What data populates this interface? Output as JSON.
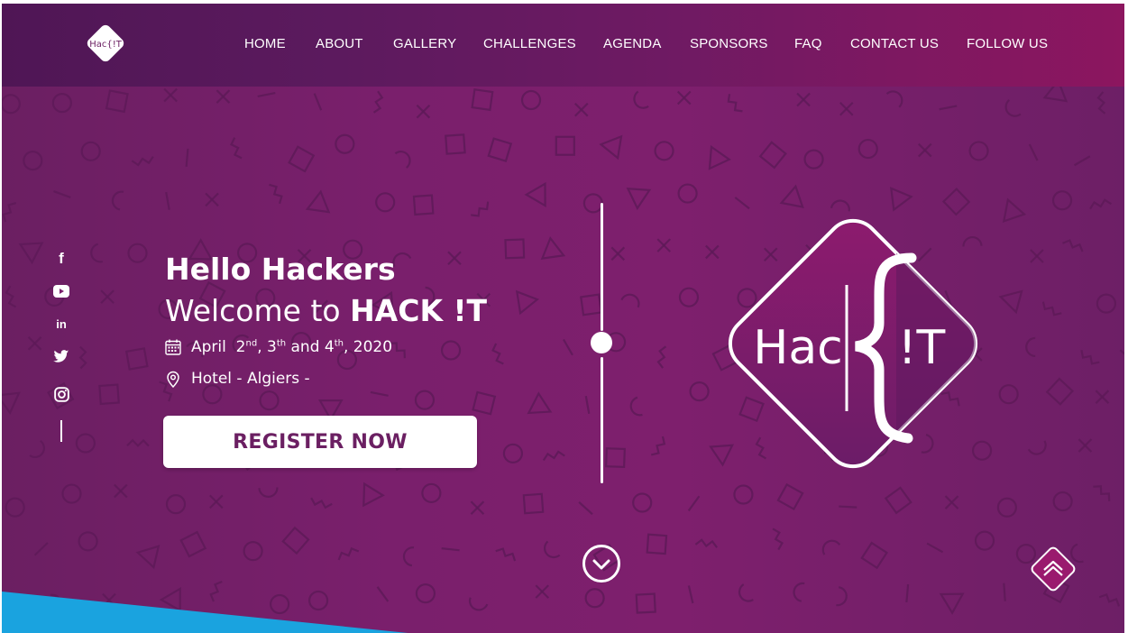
{
  "brand": {
    "logo_text": "Hac{!T",
    "name": "HACK !T"
  },
  "nav": {
    "items": [
      {
        "label": "HOME"
      },
      {
        "label": "ABOUT"
      },
      {
        "label": "GALLERY"
      },
      {
        "label": "CHALLENGES"
      },
      {
        "label": "AGENDA"
      },
      {
        "label": "SPONSORS"
      },
      {
        "label": "FAQ"
      },
      {
        "label": "CONTACT US"
      },
      {
        "label": "FOLLOW US"
      }
    ]
  },
  "socials": [
    {
      "icon": "facebook-icon",
      "glyph": "f"
    },
    {
      "icon": "youtube-icon"
    },
    {
      "icon": "linkedin-icon",
      "glyph": "in"
    },
    {
      "icon": "twitter-icon"
    },
    {
      "icon": "instagram-icon"
    }
  ],
  "hero": {
    "title_line1": "Hello Hackers",
    "title_line2_prefix": "Welcome to ",
    "title_line2_bold": "HACK !T",
    "date": {
      "month": "April",
      "d1": "2",
      "d1_sup": "nd",
      "sep1": ", ",
      "d2": "3",
      "d2_sup": "th",
      "and": " and ",
      "d3": "4",
      "d3_sup": "th",
      "year": ", 2020"
    },
    "location": "Hotel - Algiers -",
    "register_label": "REGISTER NOW"
  },
  "big_logo": {
    "left": "Hac",
    "right": "!T"
  },
  "colors": {
    "primary": "#7a1f6c",
    "nav_start": "#4f1655",
    "nav_end": "#8c165f",
    "accent_blue": "#1aa3df",
    "text": "#ffffff"
  }
}
